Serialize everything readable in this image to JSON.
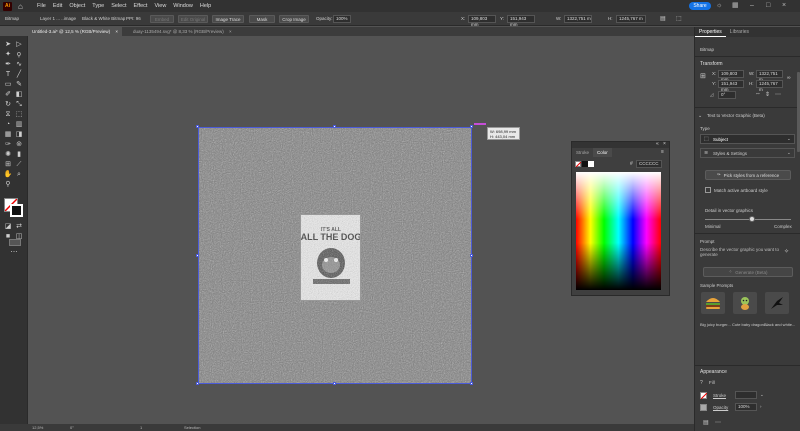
{
  "menubar": {
    "app_logo": "Ai",
    "menus": [
      "File",
      "Edit",
      "Object",
      "Type",
      "Select",
      "Effect",
      "View",
      "Window",
      "Help"
    ],
    "share_label": "Share"
  },
  "controlbar": {
    "object_type": "Bitmap",
    "linked_file": "Layer 1 ... ..image",
    "color_mode": "Black & White Bitmap",
    "ppi": "PPI: 96",
    "embed_label": "Embed",
    "edit_original_label": "Edit Original",
    "image_trace_label": "Image Trace",
    "mask_label": "Mask",
    "crop_label": "Crop Image",
    "opacity_label": "Opacity:",
    "opacity_value": "100%",
    "x_label": "X:",
    "x_value": "109,803 mm",
    "y_label": "Y:",
    "y_value": "151,943 mm",
    "w_label": "W:",
    "w_value": "1322,751 m",
    "h_label": "H:",
    "h_value": "1245,767 m"
  },
  "tabs": [
    {
      "label": "Untitled-3.ai* @ 12,5 % (RGB/Preview)",
      "active": true
    },
    {
      "label": "duay-1135494.svg* @ 8,33 % (RGB/Preview)",
      "active": false
    }
  ],
  "canvas": {
    "tooltip_w": "W: 698,99 mm",
    "tooltip_h": "H: 443,04 mm"
  },
  "status": {
    "zoom": "12,5%",
    "angle": "0°",
    "page": "1",
    "tool": "Selection"
  },
  "colorpanel": {
    "tab_stroke": "Stroke",
    "tab_color": "Color",
    "hex": "CCCCCC"
  },
  "rightpanel": {
    "tab_properties": "Properties",
    "tab_libraries": "Libraries",
    "selection_type": "Bitmap",
    "transform_title": "Transform",
    "x_label": "X:",
    "x_value": "109,803 mm",
    "y_label": "Y:",
    "y_value": "151,943 mm",
    "w_label": "W:",
    "w_value": "1322,751 m",
    "h_label": "H:",
    "h_value": "1245,767 m",
    "angle_value": "0°",
    "ttv_title": "Text to Vector Graphic (Beta)",
    "type_label": "Type",
    "type_value": "Subject",
    "styles_label": "Styles & Settings",
    "pick_styles_label": "Pick styles from a reference",
    "match_label": "Match active artboard style",
    "detail_label": "Detail in vector graphics",
    "detail_min": "Minimal",
    "detail_max": "Complex",
    "detail_value": 0.55,
    "prompt_label": "Prompt",
    "prompt_placeholder": "Describe the vector graphic you want to generate",
    "generate_label": "Generate (Beta)",
    "samples_label": "Sample Prompts",
    "samples": [
      "Big juicy burger...",
      "Cute baby dragon...",
      "Black and white..."
    ],
    "appearance_title": "Appearance",
    "fill_label": "Fill",
    "stroke_label": "Stroke",
    "opacity_label": "Opacity",
    "opacity_value": "100%"
  }
}
